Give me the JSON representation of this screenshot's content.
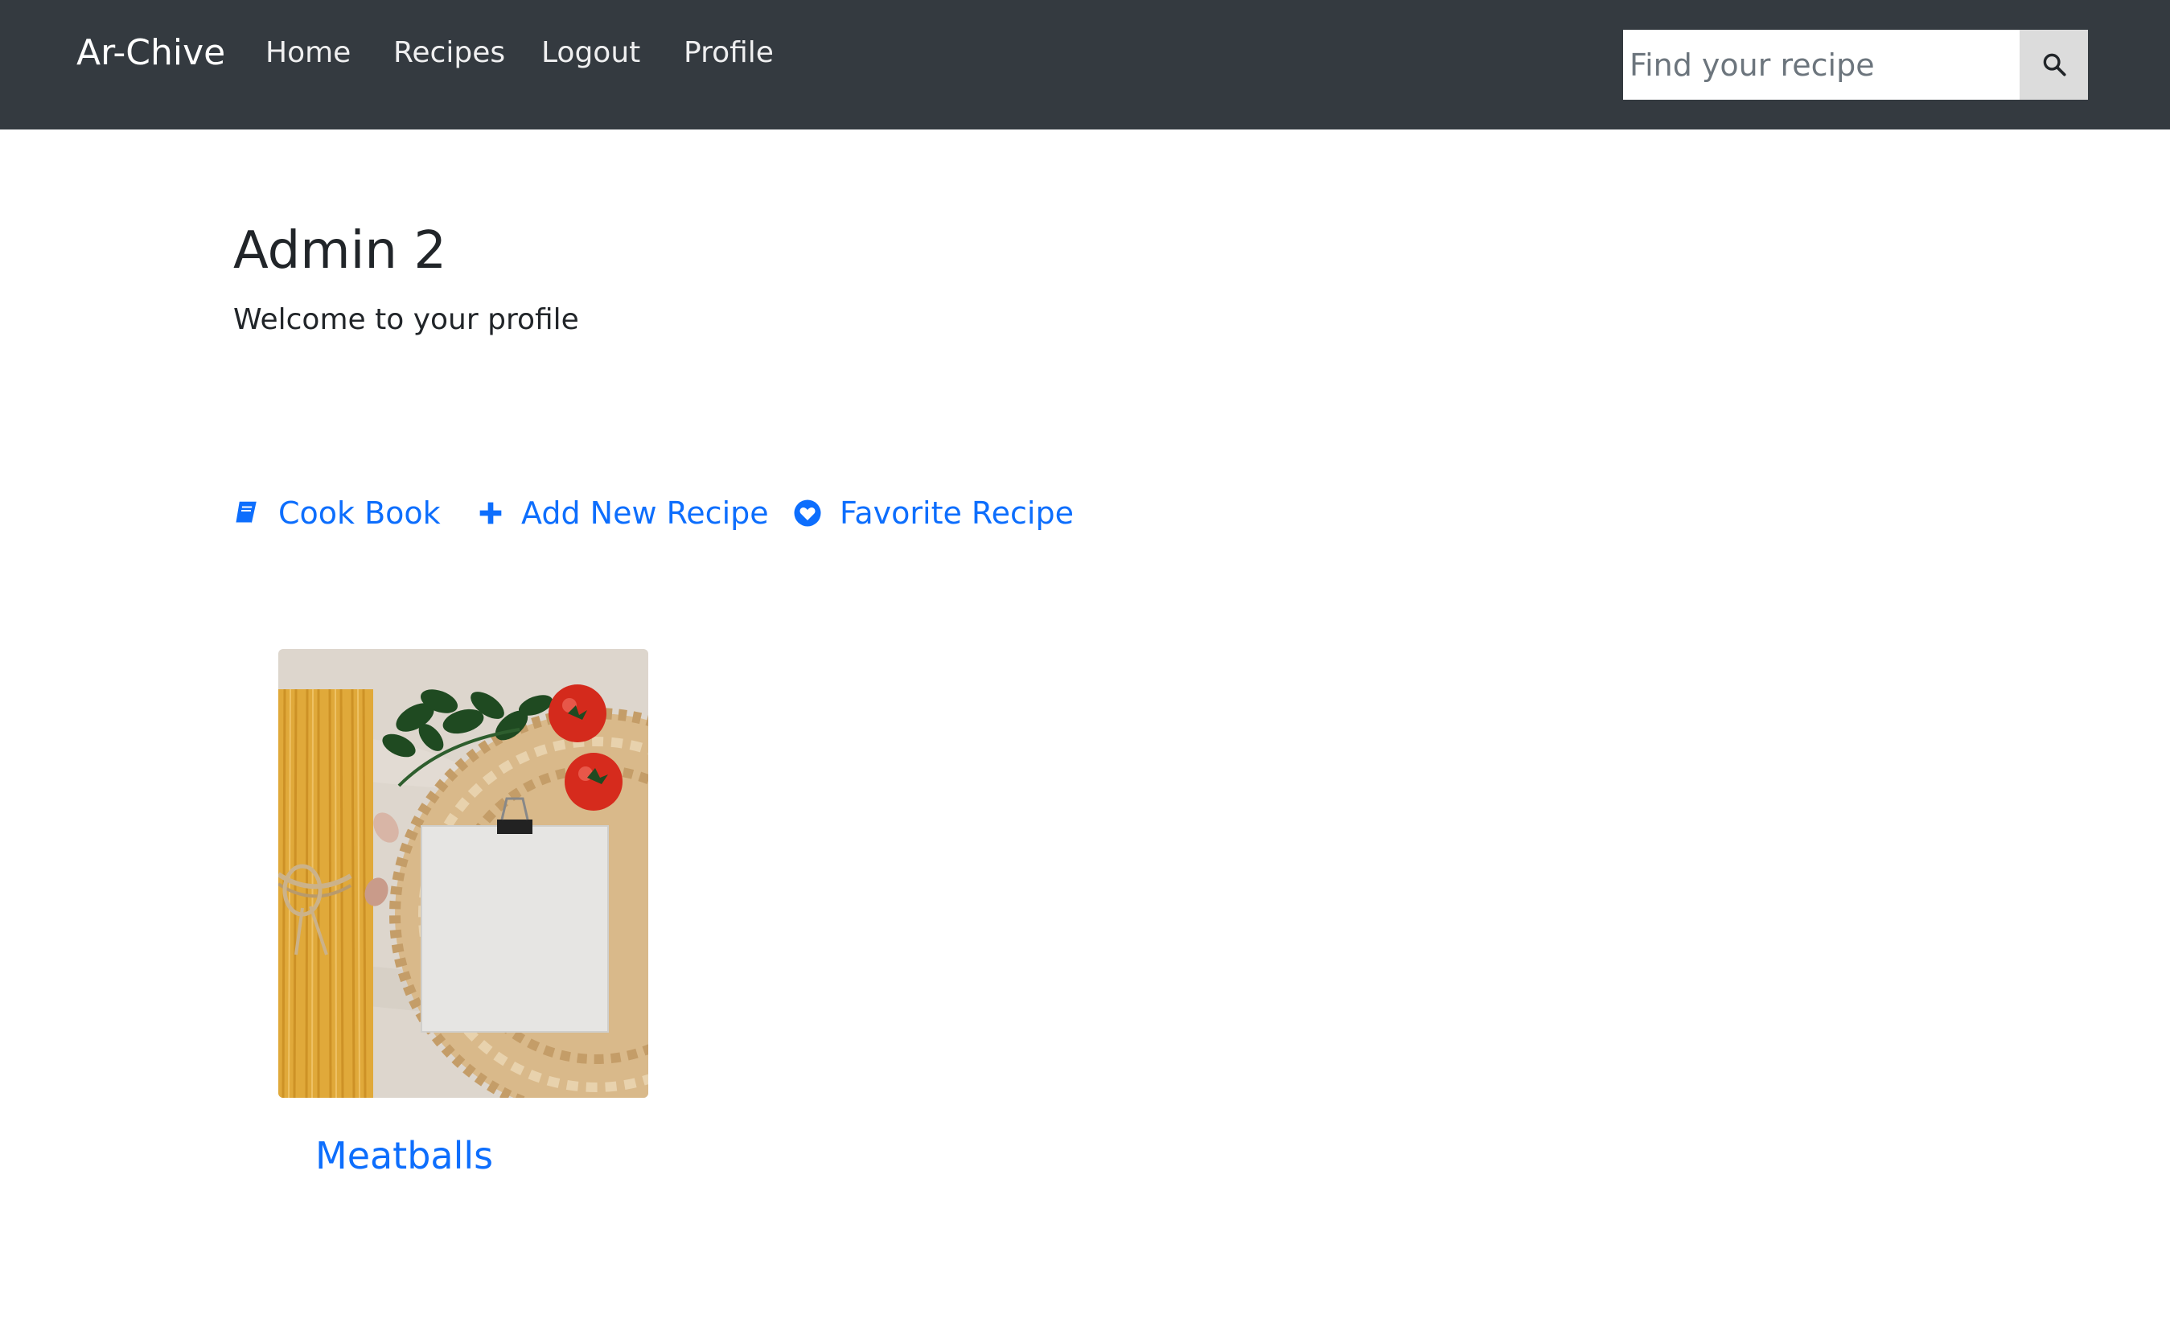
{
  "navbar": {
    "brand": "Ar-Chive",
    "links": [
      {
        "label": "Home"
      },
      {
        "label": "Recipes"
      },
      {
        "label": "Logout"
      },
      {
        "label": "Profile"
      }
    ],
    "search": {
      "placeholder": "Find your recipe",
      "value": "",
      "button_icon": "search-icon"
    },
    "colors": {
      "background": "#343a40",
      "text": "#ffffff"
    }
  },
  "profile": {
    "name": "Admin 2",
    "welcome": "Welcome to your profile"
  },
  "actions": [
    {
      "label": "Cook Book",
      "icon": "book-icon"
    },
    {
      "label": "Add New Recipe",
      "icon": "plus-icon"
    },
    {
      "label": "Favorite Recipe",
      "icon": "heart-circle-icon"
    }
  ],
  "recipes": [
    {
      "title": "Meatballs",
      "image": "pasta-ingredients-photo"
    }
  ],
  "colors": {
    "accent": "#0d6efd",
    "text": "#212529"
  }
}
